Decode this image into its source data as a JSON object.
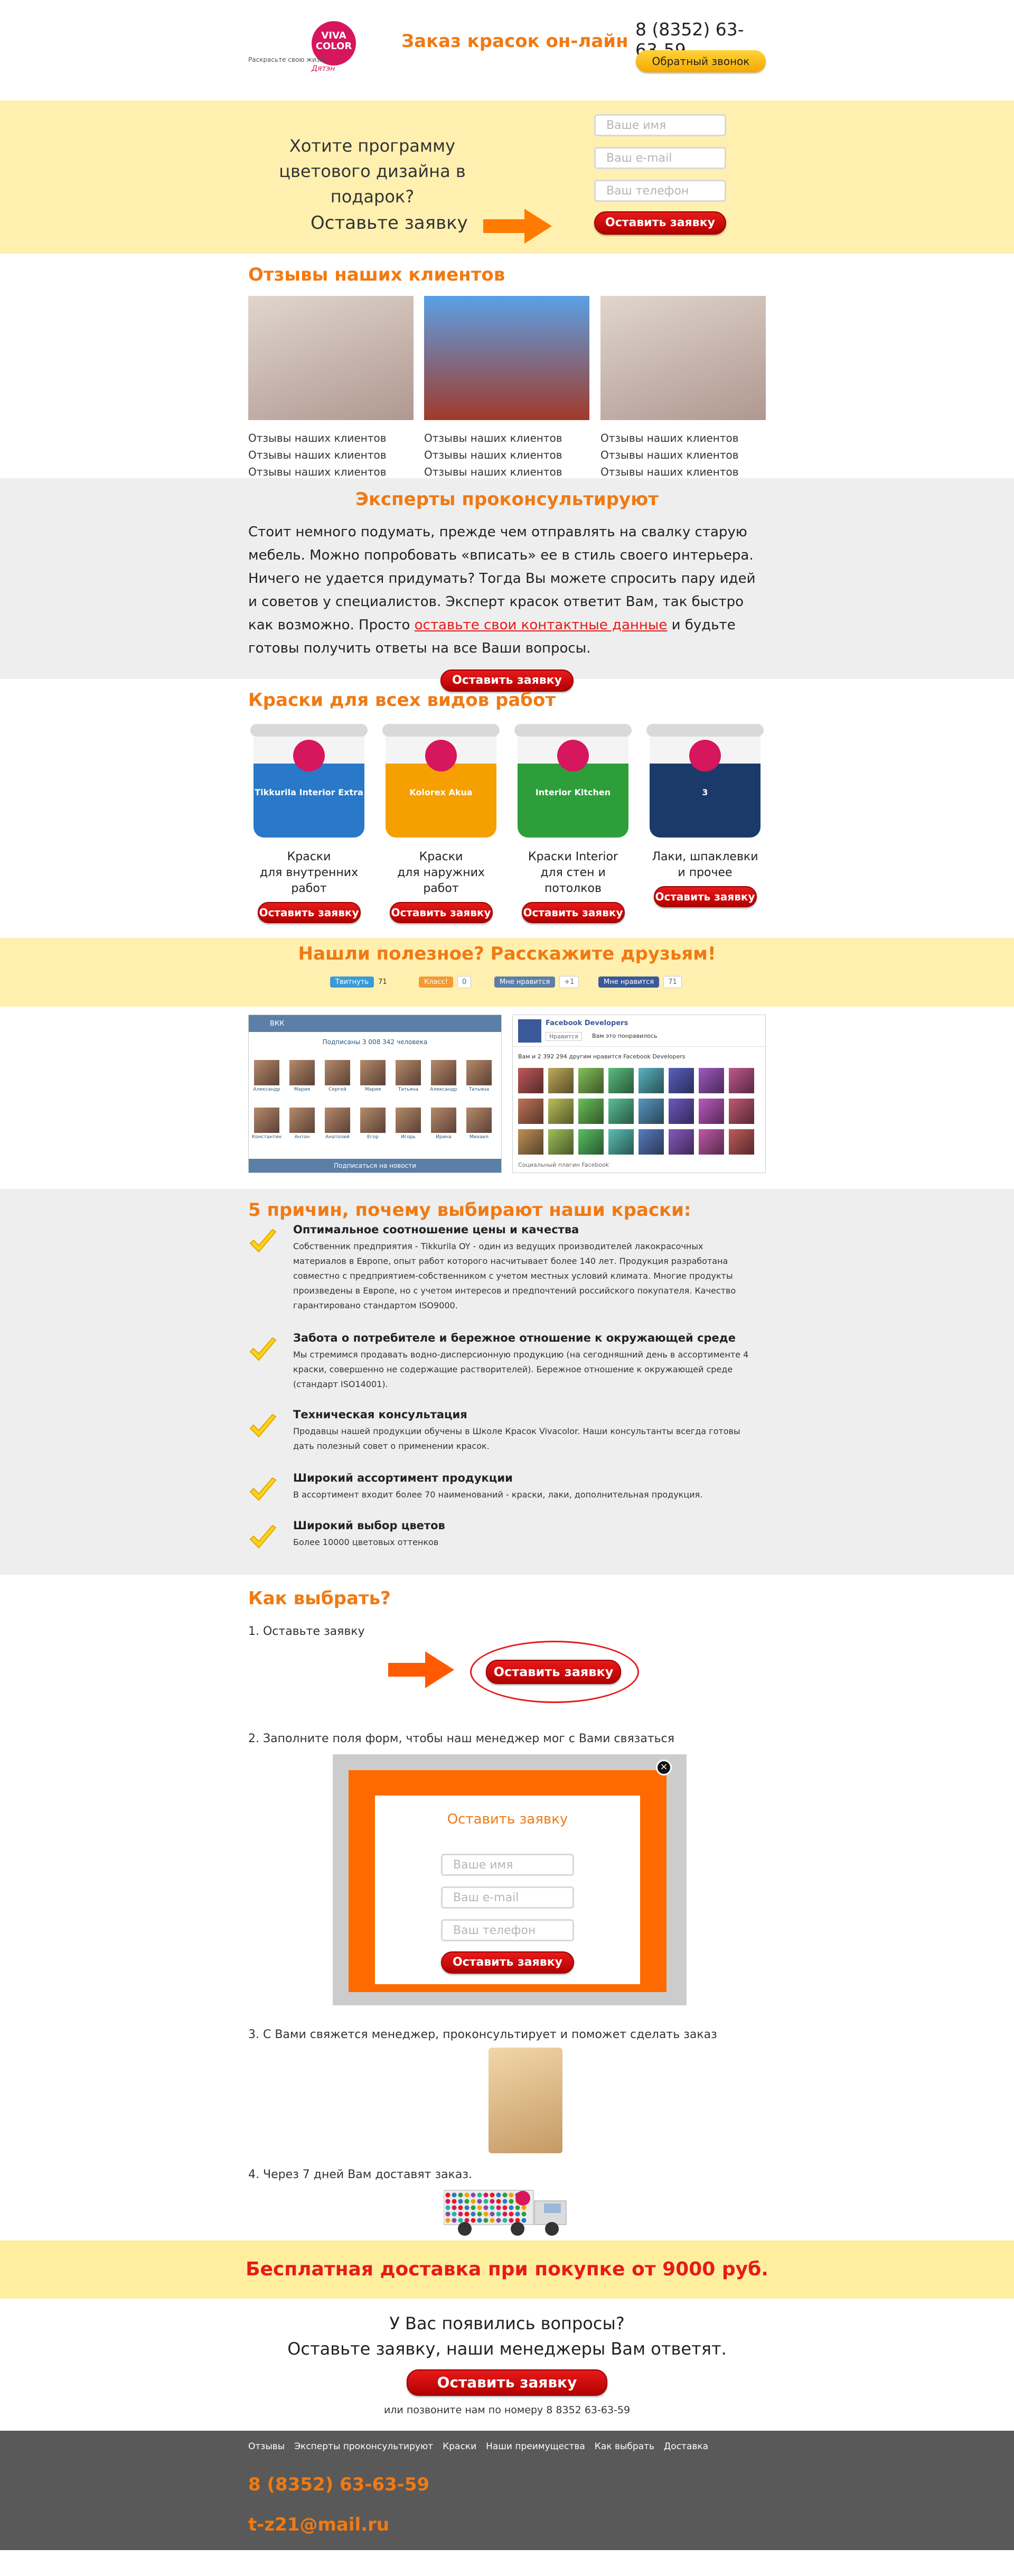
{
  "header": {
    "logo_text": "VIVA COLOR",
    "logo_tagline": "Раскрасьте свою жизнь",
    "logo_signature": "Дятэн",
    "title": "Заказ красок он-лайн",
    "phone": "8 (8352) 63-63-59",
    "callback_label": "Обратный звонок"
  },
  "promo": {
    "question": "Хотите программу цветового дизайна в подарок?",
    "leave_request": "Оставьте заявку",
    "name_placeholder": "Ваше имя",
    "email_placeholder": "Ваш e-mail",
    "phone_placeholder": "Ваш телефон",
    "submit_label": "Оставить заявку"
  },
  "reviews": {
    "title": "Отзывы наших клиентов",
    "items": [
      {
        "text": "Отзывы наших клиентов Отзывы наших клиентов Отзывы наших клиентов"
      },
      {
        "text": "Отзывы наших клиентов Отзывы наших клиентов Отзывы наших клиентов"
      },
      {
        "text": "Отзывы наших клиентов Отзывы наших клиентов Отзывы наших клиентов"
      }
    ]
  },
  "experts": {
    "title": "Эксперты проконсультируют",
    "text_before": "Стоит немного подумать, прежде чем отправлять на свалку старую мебель. Можно попробовать «вписать» ее в стиль своего интерьера. Ничего не удается придумать? Тогда Вы можете спросить пару идей и советов у специалистов. Эксперт красок ответит Вам, так быстро как возможно. Просто ",
    "link_text": "оставьте свои контактные данные",
    "text_after": " и будьте готовы получить ответы на все Ваши вопросы.",
    "button_label": "Оставить заявку"
  },
  "paints": {
    "title": "Краски для всех видов работ",
    "items": [
      {
        "line1": "Краски",
        "line2": "для внутренних работ",
        "button": "Оставить заявку",
        "product": "Tikkurila Interior Extra",
        "color": "#2a78c8"
      },
      {
        "line1": "Краски",
        "line2": "для наружних работ",
        "button": "Оставить заявку",
        "product": "Kolorex Akua",
        "color": "#f5a000"
      },
      {
        "line1": "Краски Interior",
        "line2": "для стен и потолков",
        "button": "Оставить заявку",
        "product": "Interior Kitchen",
        "color": "#2e9e3a"
      },
      {
        "line1": "Лаки, шпаклевки",
        "line2": "и прочее",
        "button": "Оставить заявку",
        "product": "3",
        "color": "#1b3a6a"
      }
    ]
  },
  "share": {
    "title": "Нашли полезное? Расскажите друзьям!",
    "buttons": [
      {
        "label": "Твитнуть",
        "count": "71",
        "color": "#3a9bd8"
      },
      {
        "label": "Класс!",
        "count": "0",
        "color": "#f29b34"
      },
      {
        "label": "Мне нравится",
        "count": "+1",
        "color": "#5b7fa6"
      },
      {
        "label": "Мне нравится",
        "count": "71",
        "color": "#3b5998"
      }
    ]
  },
  "vk_widget": {
    "title": "ВКК",
    "subscribers": "Подписаны 3 008 342 человека",
    "names": [
      "Александр",
      "Мария",
      "Сергей",
      "Мария",
      "Татьяна",
      "Александр",
      "Татьяна",
      "Константин",
      "Антон",
      "Анатолий",
      "Егор",
      "Игорь",
      "Ирина",
      "Михаил"
    ],
    "footer_button": "Подписаться на новости"
  },
  "fb_widget": {
    "title": "Facebook Developers",
    "like_label": "Нравится",
    "like_text": "Вам это понравилось",
    "count_text": "Вам и 2 392 294 другим нравится Facebook Developers",
    "footer": "Социальный плагин Facebook"
  },
  "reasons": {
    "title": "5 причин, почему выбирают наши краски:",
    "items": [
      {
        "heading": "Оптимальное соотношение цены и качества",
        "text": "Собственник предприятия - Tikkurila OY - один из ведущих производителей лакокрасочных материалов в Европе, опыт работ которого насчитывает более 140 лет. Продукция разработана совместно с предприятием-собственником с учетом местных условий климата. Многие продукты произведены в Европе, но с учетом интересов и предпочтений российского покупателя. Качество гарантировано стандартом ISO9000."
      },
      {
        "heading": "Забота о потребителе и бережное отношение к окружающей среде",
        "text": "Мы стремимся продавать водно-дисперсионную продукцию (на сегодняшний день в ассортименте 4 краски, совершенно не содержащие растворителей). Бережное отношение к окружающей среде (стандарт ISO14001)."
      },
      {
        "heading": "Техническая консультация",
        "text": "Продавцы нашей продукции обучены в Школе Красок Vivacolor. Наши консультанты всегда готовы дать полезный совет о применении красок."
      },
      {
        "heading": "Широкий ассортимент продукции",
        "text": "В ассортимент входит более 70 наименований - краски, лаки, дополнительная продукция."
      },
      {
        "heading": "Широкий выбор цветов",
        "text": "Более 10000 цветовых оттенков"
      }
    ]
  },
  "how": {
    "title": "Как выбрать?",
    "step1": "1. Оставьте заявку",
    "step1_button": "Оставить заявку",
    "step2": "2. Заполните поля форм, чтобы наш менеджер мог с Вами связаться",
    "modal_title": "Оставить заявку",
    "modal_name": "Ваше имя",
    "modal_email": "Ваш e-mail",
    "modal_phone": "Ваш телефон",
    "modal_button": "Оставить заявку",
    "modal_close": "×",
    "step3": "3. С Вами свяжется менеджер, проконсультирует и поможет сделать заказ",
    "step4": "4. Через 7 дней Вам доставят заказ."
  },
  "delivery": {
    "text": "Бесплатная доставка при покупке от 9000 руб."
  },
  "question": {
    "line1": "У Вас появились вопросы?",
    "line2": "Оставьте заявку, наши менеджеры Вам ответят.",
    "button": "Оставить заявку",
    "call_text": "или позвоните нам по номеру 8 8352 63-63-59"
  },
  "footer": {
    "nav": [
      "Отзывы",
      "Эксперты проконсультируют",
      "Краски",
      "Наши преимущества",
      "Как выбрать",
      "Доставка"
    ],
    "phone": "8 (8352) 63-63-59",
    "email": "t-z21@mail.ru"
  },
  "colors": {
    "accent_orange": "#f07a14",
    "button_red": "#d90f0f",
    "callback_yellow": "#ffc21a",
    "band_yellow": "#fff0b0",
    "band_gray": "#eeeeee",
    "footer_gray": "#595959"
  }
}
